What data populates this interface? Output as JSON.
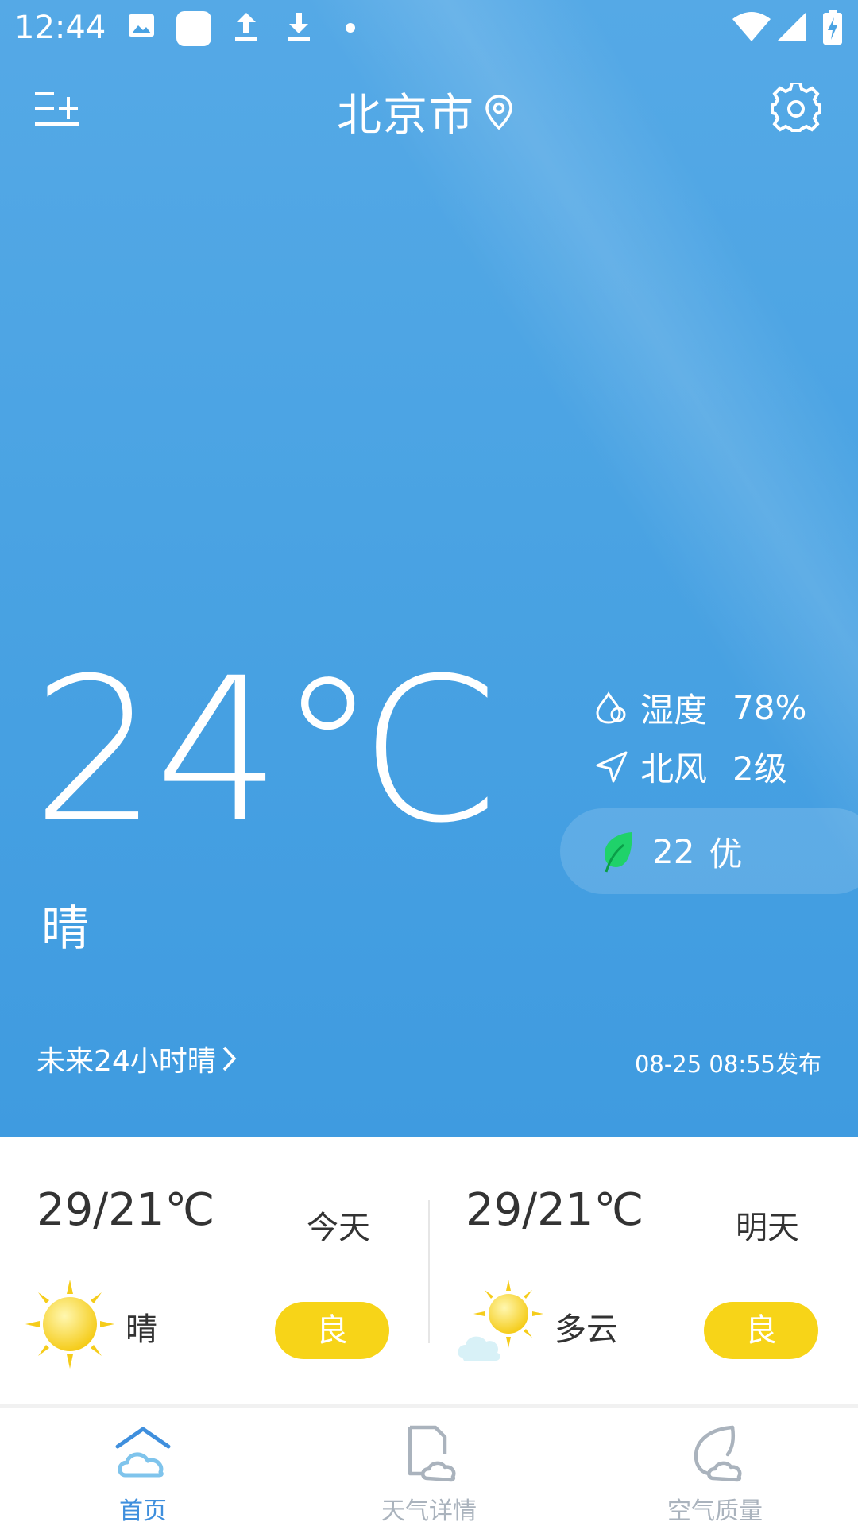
{
  "status_bar": {
    "time": "12:44"
  },
  "header": {
    "city": "北京市"
  },
  "current": {
    "temperature": "24℃",
    "condition": "晴",
    "humidity_label": "湿度",
    "humidity_value": "78%",
    "wind_direction": "北风",
    "wind_level": "2级",
    "aqi_value": "22",
    "aqi_level": "优",
    "forecast_link": "未来24小时晴",
    "publish_time": "08-25 08:55发布"
  },
  "forecast": [
    {
      "range": "29/21℃",
      "day": "今天",
      "condition": "晴",
      "quality": "良",
      "icon": "sun-icon"
    },
    {
      "range": "29/21℃",
      "day": "明天",
      "condition": "多云",
      "quality": "良",
      "icon": "partly-cloudy-icon"
    }
  ],
  "nav": {
    "items": [
      {
        "label": "首页",
        "icon": "home-icon",
        "active": true
      },
      {
        "label": "天气详情",
        "icon": "weather-detail-icon",
        "active": false
      },
      {
        "label": "空气质量",
        "icon": "air-quality-icon",
        "active": false
      }
    ]
  },
  "colors": {
    "hero_blue": "#4aa3e3",
    "badge_yellow": "#f7d418",
    "nav_active": "#3f8fdd",
    "aqi_green": "#1fd26a"
  }
}
